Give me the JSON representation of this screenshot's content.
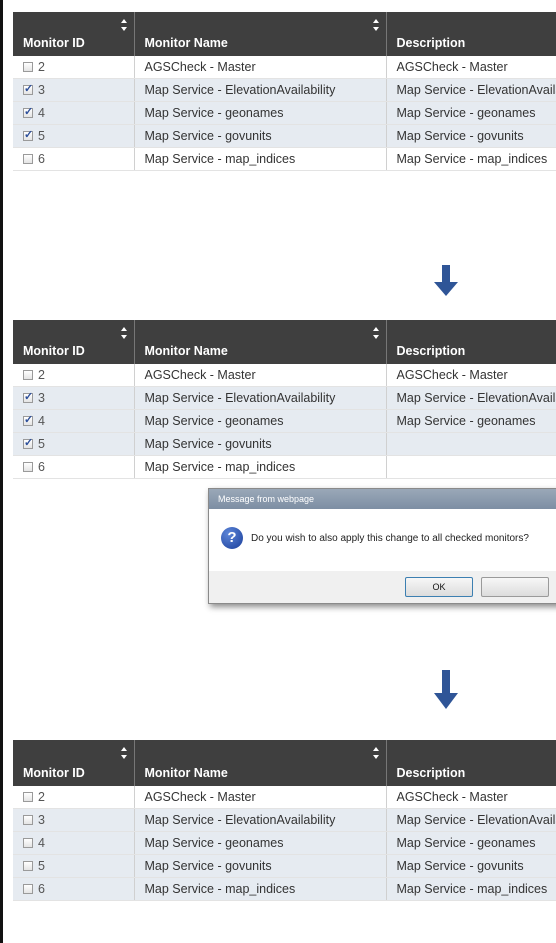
{
  "columns": {
    "monitor_id": "Monitor ID",
    "monitor_name": "Monitor Name",
    "description": "Description"
  },
  "panels": [
    {
      "rows": [
        {
          "id": "2",
          "name": "AGSCheck - Master",
          "desc": "AGSCheck - Master",
          "checked": false
        },
        {
          "id": "3",
          "name": "Map Service - ElevationAvailability",
          "desc": "Map Service - ElevationAvailability",
          "checked": true
        },
        {
          "id": "4",
          "name": "Map Service - geonames",
          "desc": "Map Service - geonames",
          "checked": true
        },
        {
          "id": "5",
          "name": "Map Service - govunits",
          "desc": "Map Service - govunits",
          "checked": true
        },
        {
          "id": "6",
          "name": "Map Service - map_indices",
          "desc": "Map Service - map_indices",
          "checked": false
        }
      ]
    },
    {
      "rows": [
        {
          "id": "2",
          "name": "AGSCheck - Master",
          "desc": "AGSCheck - Master",
          "checked": false
        },
        {
          "id": "3",
          "name": "Map Service - ElevationAvailability",
          "desc": "Map Service - ElevationAvailability",
          "checked": true
        },
        {
          "id": "4",
          "name": "Map Service - geonames",
          "desc": "Map Service - geonames",
          "checked": true
        },
        {
          "id": "5",
          "name": "Map Service - govunits",
          "desc": "",
          "checked": true
        },
        {
          "id": "6",
          "name": "Map Service - map_indices",
          "desc": "",
          "checked": false
        }
      ]
    },
    {
      "rows": [
        {
          "id": "2",
          "name": "AGSCheck - Master",
          "desc": "AGSCheck - Master",
          "checked": false
        },
        {
          "id": "3",
          "name": "Map Service - ElevationAvailability",
          "desc": "Map Service - ElevationAvailability",
          "checked": false
        },
        {
          "id": "4",
          "name": "Map Service - geonames",
          "desc": "Map Service - geonames",
          "checked": false
        },
        {
          "id": "5",
          "name": "Map Service - govunits",
          "desc": "Map Service - govunits",
          "checked": false
        },
        {
          "id": "6",
          "name": "Map Service - map_indices",
          "desc": "Map Service - map_indices",
          "checked": false
        }
      ]
    }
  ],
  "dialog": {
    "title": "Message from webpage",
    "message": "Do you wish to also apply this change to all checked monitors?",
    "ok_label": "OK",
    "icon": "question-icon"
  },
  "colors": {
    "header_bg": "#3f3f3f",
    "alt_row_bg": "#e6ebf1",
    "arrow": "#2f5597"
  }
}
